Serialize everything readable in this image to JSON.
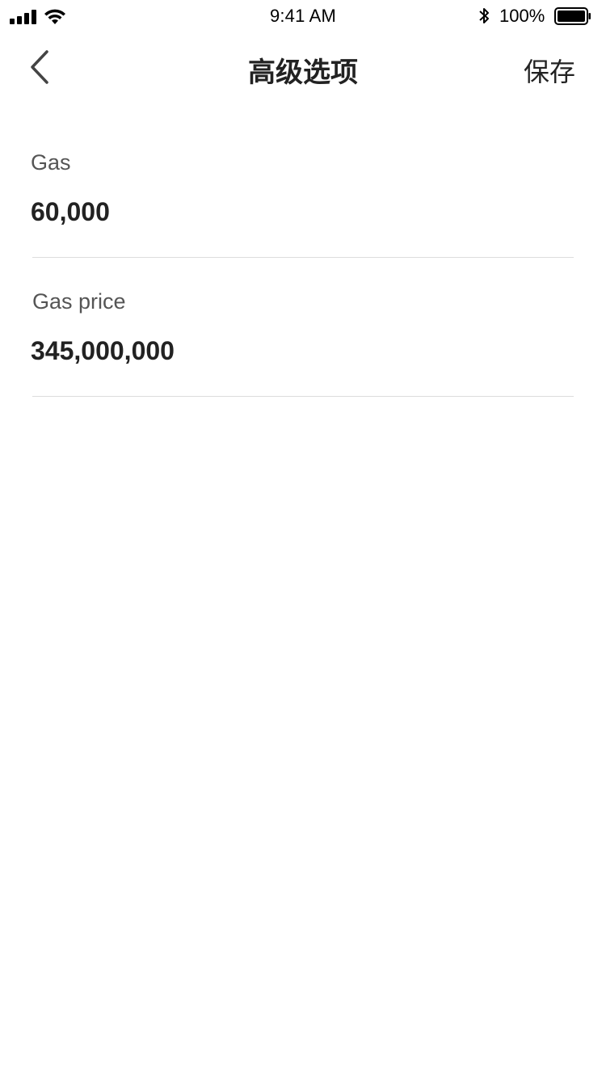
{
  "status_bar": {
    "time": "9:41 AM",
    "battery_percent": "100%"
  },
  "nav": {
    "title": "高级选项",
    "save_label": "保存"
  },
  "form": {
    "fields": [
      {
        "label": "Gas",
        "value": "60,000"
      },
      {
        "label": "Gas price",
        "value": "345,000,000"
      }
    ]
  }
}
